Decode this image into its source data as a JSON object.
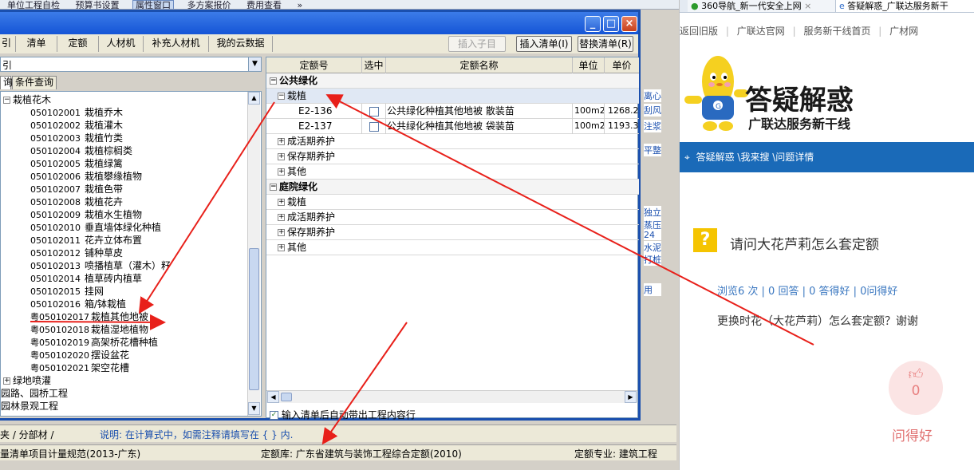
{
  "top_toolbar": {
    "items": [
      "单位工程自检",
      "预算书设置",
      "属性窗口",
      "多方案报价",
      "费用查看",
      "»"
    ]
  },
  "dialog": {
    "title": "",
    "tabs": [
      "引",
      "清单",
      "定额",
      "人材机",
      "补充人材机",
      "我的云数据"
    ],
    "buttons": {
      "insert_sub": "插入子目",
      "insert_list": "插入清单(I)",
      "replace_list": "替换清单(R)"
    },
    "left": {
      "combo_value": "引",
      "subtabs": [
        "询",
        "条件查询"
      ],
      "tree": {
        "root": "栽植花木",
        "items": [
          {
            "code": "050102001",
            "name": "栽植乔木"
          },
          {
            "code": "050102002",
            "name": "栽植灌木"
          },
          {
            "code": "050102003",
            "name": "栽植竹类"
          },
          {
            "code": "050102004",
            "name": "栽植棕榈类"
          },
          {
            "code": "050102005",
            "name": "栽植绿篱"
          },
          {
            "code": "050102006",
            "name": "栽植攀缘植物"
          },
          {
            "code": "050102007",
            "name": "栽植色带"
          },
          {
            "code": "050102008",
            "name": "栽植花卉"
          },
          {
            "code": "050102009",
            "name": "栽植水生植物"
          },
          {
            "code": "050102010",
            "name": "垂直墙体绿化种植"
          },
          {
            "code": "050102011",
            "name": "花卉立体布置"
          },
          {
            "code": "050102012",
            "name": "铺种草皮"
          },
          {
            "code": "050102013",
            "name": "喷播植草（灌木）籽"
          },
          {
            "code": "050102014",
            "name": "植草砖内植草"
          },
          {
            "code": "050102015",
            "name": "挂网"
          },
          {
            "code": "050102016",
            "name": "箱/钵栽植"
          },
          {
            "code": "粤050102017",
            "name": "栽植其他地被"
          },
          {
            "code": "粤050102018",
            "name": "栽植湿地植物"
          },
          {
            "code": "粤050102019",
            "name": "高架桥花槽种植"
          },
          {
            "code": "粤050102020",
            "name": "摆设盆花"
          },
          {
            "code": "粤050102021",
            "name": "架空花槽"
          }
        ],
        "after": [
          {
            "pm": "+",
            "name": "绿地喷灌"
          },
          {
            "pm": "",
            "name": "园路、园桥工程"
          },
          {
            "pm": "",
            "name": "园林景观工程"
          }
        ]
      }
    },
    "grid": {
      "headers": [
        "定额号",
        "选中",
        "定额名称",
        "单位",
        "单价"
      ],
      "rows": [
        {
          "kind": "grp",
          "pm": "−",
          "name": "公共绿化"
        },
        {
          "kind": "sub",
          "pm": "−",
          "name": "栽植"
        },
        {
          "kind": "item",
          "code": "E2-136",
          "name": "公共绿化种植其他地被 散装苗",
          "unit": "100m2",
          "price": "1268.2"
        },
        {
          "kind": "item",
          "code": "E2-137",
          "name": "公共绿化种植其他地被 袋装苗",
          "unit": "100m2",
          "price": "1193.3"
        },
        {
          "kind": "sub",
          "pm": "+",
          "name": "成活期养护"
        },
        {
          "kind": "sub",
          "pm": "+",
          "name": "保存期养护"
        },
        {
          "kind": "sub",
          "pm": "+",
          "name": "其他"
        },
        {
          "kind": "grp",
          "pm": "−",
          "name": "庭院绿化"
        },
        {
          "kind": "sub",
          "pm": "+",
          "name": "栽植"
        },
        {
          "kind": "sub",
          "pm": "+",
          "name": "成活期养护"
        },
        {
          "kind": "sub",
          "pm": "+",
          "name": "保存期养护"
        },
        {
          "kind": "sub",
          "pm": "+",
          "name": "其他"
        }
      ],
      "footer_check": "输入清单后自动带出工程内容行"
    }
  },
  "side_strip": [
    "离心",
    "刮风",
    "注浆",
    "平整",
    "独立",
    "蒸压",
    "24",
    "水泥",
    "打桩",
    "用"
  ],
  "status": {
    "tabs": "夹 / 分部材 /",
    "note": "说明: 在计算式中，如需注释请填写在 { } 内.",
    "left": "量清单项目计量规范(2013-广东)",
    "middle": "定额库: 广东省建筑与装饰工程综合定额(2010)",
    "right": "定额专业: 建筑工程"
  },
  "browser": {
    "tabs": [
      "360导航_新一代安全上网",
      "答疑解惑_广联达服务新干"
    ],
    "nav_links": [
      "返回旧版",
      "广联达官网",
      "服务新干线首页",
      "广材网"
    ],
    "logo_title": "答疑解惑",
    "logo_sub": "广联达服务新干线",
    "breadcrumb": "答疑解惑 \\我来搜 \\问题详情",
    "question_title": "请问大花芦莉怎么套定额",
    "stats": "浏览6 次 | 0 回答 | 0 答得好 | 0问得好",
    "question_body": "更换时花（大花芦莉）怎么套定额？谢谢",
    "like_count": "0",
    "like_label": "问得好"
  }
}
